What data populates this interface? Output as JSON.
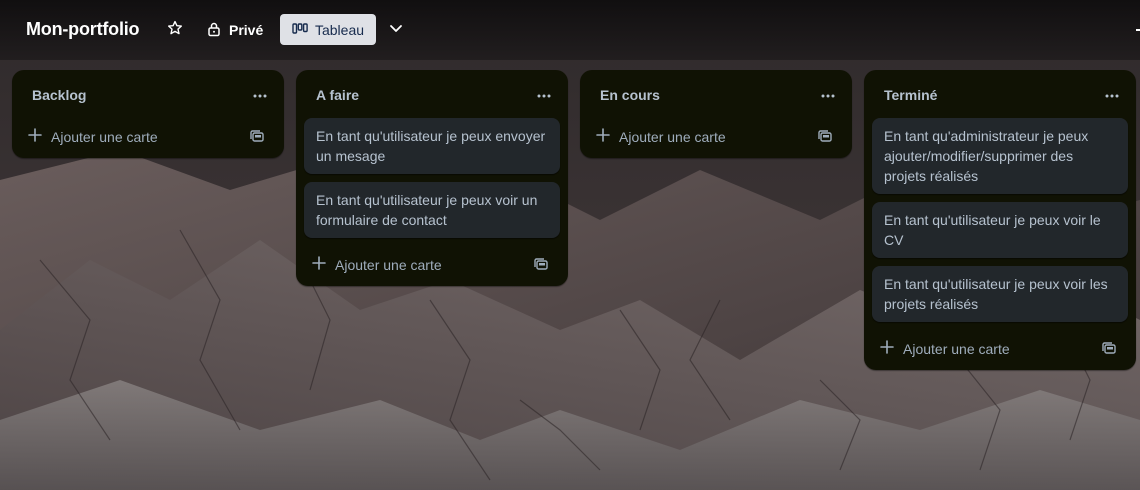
{
  "board": {
    "title": "Mon-portfolio",
    "visibility_label": "Privé",
    "view_label": "Tableau"
  },
  "icons": {
    "star": "star-icon",
    "lock": "lock-icon",
    "board_view": "board-view-icon",
    "chevron": "chevron-down-icon",
    "more": "more-horizontal-icon",
    "plus": "plus-icon",
    "template": "card-template-icon"
  },
  "colors": {
    "list_bg": "#101204",
    "card_bg": "#22272b",
    "text": "#b6c2cf",
    "view_button_bg": "#dfe1e6"
  },
  "lists": [
    {
      "title": "Backlog",
      "cards": [],
      "add_label": "Ajouter une carte"
    },
    {
      "title": "A faire",
      "cards": [
        "En tant qu'utilisateur je peux envoyer un mesage",
        "En tant qu'utilisateur je peux voir un formulaire de contact"
      ],
      "add_label": "Ajouter une carte"
    },
    {
      "title": "En cours",
      "cards": [],
      "add_label": "Ajouter une carte"
    },
    {
      "title": "Terminé",
      "cards": [
        "En tant qu'administrateur je peux ajouter/modifier/supprimer des projets réalisés",
        "En tant qu'utilisateur je peux voir le CV",
        "En tant qu'utilisateur je peux voir les projets réalisés"
      ],
      "add_label": "Ajouter une carte"
    }
  ]
}
